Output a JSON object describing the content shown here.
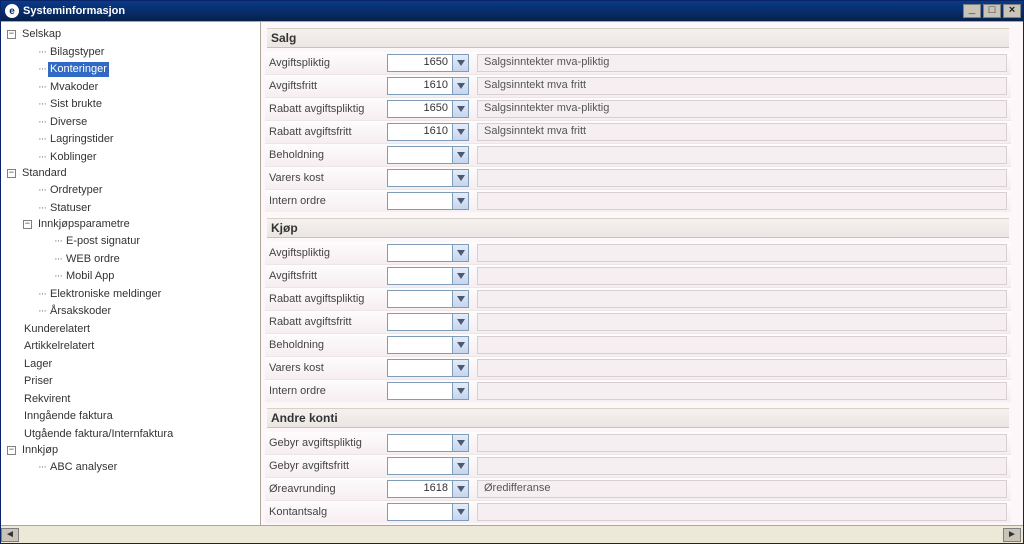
{
  "window": {
    "title": "Systeminformasjon"
  },
  "tree": {
    "selskap": "Selskap",
    "bilagstyper": "Bilagstyper",
    "konteringer": "Konteringer",
    "mvakoder": "Mvakoder",
    "sist_brukte": "Sist brukte",
    "diverse": "Diverse",
    "lagringstider": "Lagringstider",
    "koblinger": "Koblinger",
    "standard": "Standard",
    "ordretyper": "Ordretyper",
    "statuser": "Statuser",
    "innkjopsparam": "Innkjøpsparametre",
    "epost_sign": "E-post signatur",
    "web_ordre": "WEB ordre",
    "mobil_app": "Mobil App",
    "elektr_meld": "Elektroniske meldinger",
    "arsakskoder": "Årsakskoder",
    "kunderelatert": "Kunderelatert",
    "artikkelrelatert": "Artikkelrelatert",
    "lager": "Lager",
    "priser": "Priser",
    "rekvirent": "Rekvirent",
    "inng_faktura": "Inngående faktura",
    "utg_faktura": "Utgående faktura/Internfaktura",
    "innkjop": "Innkjøp",
    "abc_analyser": "ABC analyser"
  },
  "sections": {
    "salg": "Salg",
    "kjop": "Kjøp",
    "andre": "Andre konti"
  },
  "labels": {
    "avgiftspliktig": "Avgiftspliktig",
    "avgiftsfritt": "Avgiftsfritt",
    "rabatt_avgiftspliktig": "Rabatt avgiftspliktig",
    "rabatt_avgiftsfritt": "Rabatt avgiftsfritt",
    "beholdning": "Beholdning",
    "varers_kost": "Varers kost",
    "intern_ordre": "Intern ordre",
    "gebyr_avgiftspliktig": "Gebyr avgiftspliktig",
    "gebyr_avgiftsfritt": "Gebyr avgiftsfritt",
    "oreavrunding": "Øreavrunding",
    "kontantsalg": "Kontantsalg"
  },
  "salg": {
    "avgiftspliktig": {
      "value": "1650",
      "desc": "Salgsinntekter mva-pliktig"
    },
    "avgiftsfritt": {
      "value": "1610",
      "desc": "Salgsinntekt mva fritt"
    },
    "rabatt_avgiftspliktig": {
      "value": "1650",
      "desc": "Salgsinntekter mva-pliktig"
    },
    "rabatt_avgiftsfritt": {
      "value": "1610",
      "desc": "Salgsinntekt mva fritt"
    },
    "beholdning": {
      "value": "",
      "desc": ""
    },
    "varers_kost": {
      "value": "",
      "desc": ""
    },
    "intern_ordre": {
      "value": "",
      "desc": ""
    }
  },
  "kjop": {
    "avgiftspliktig": {
      "value": "",
      "desc": ""
    },
    "avgiftsfritt": {
      "value": "",
      "desc": ""
    },
    "rabatt_avgiftspliktig": {
      "value": "",
      "desc": ""
    },
    "rabatt_avgiftsfritt": {
      "value": "",
      "desc": ""
    },
    "beholdning": {
      "value": "",
      "desc": ""
    },
    "varers_kost": {
      "value": "",
      "desc": ""
    },
    "intern_ordre": {
      "value": "",
      "desc": ""
    }
  },
  "andre": {
    "gebyr_avgiftspliktig": {
      "value": "",
      "desc": ""
    },
    "gebyr_avgiftsfritt": {
      "value": "",
      "desc": ""
    },
    "oreavrunding": {
      "value": "1618",
      "desc": "Øredifferanse"
    },
    "kontantsalg": {
      "value": "",
      "desc": ""
    }
  },
  "glyph": {
    "minus": "−",
    "plus": "+"
  }
}
